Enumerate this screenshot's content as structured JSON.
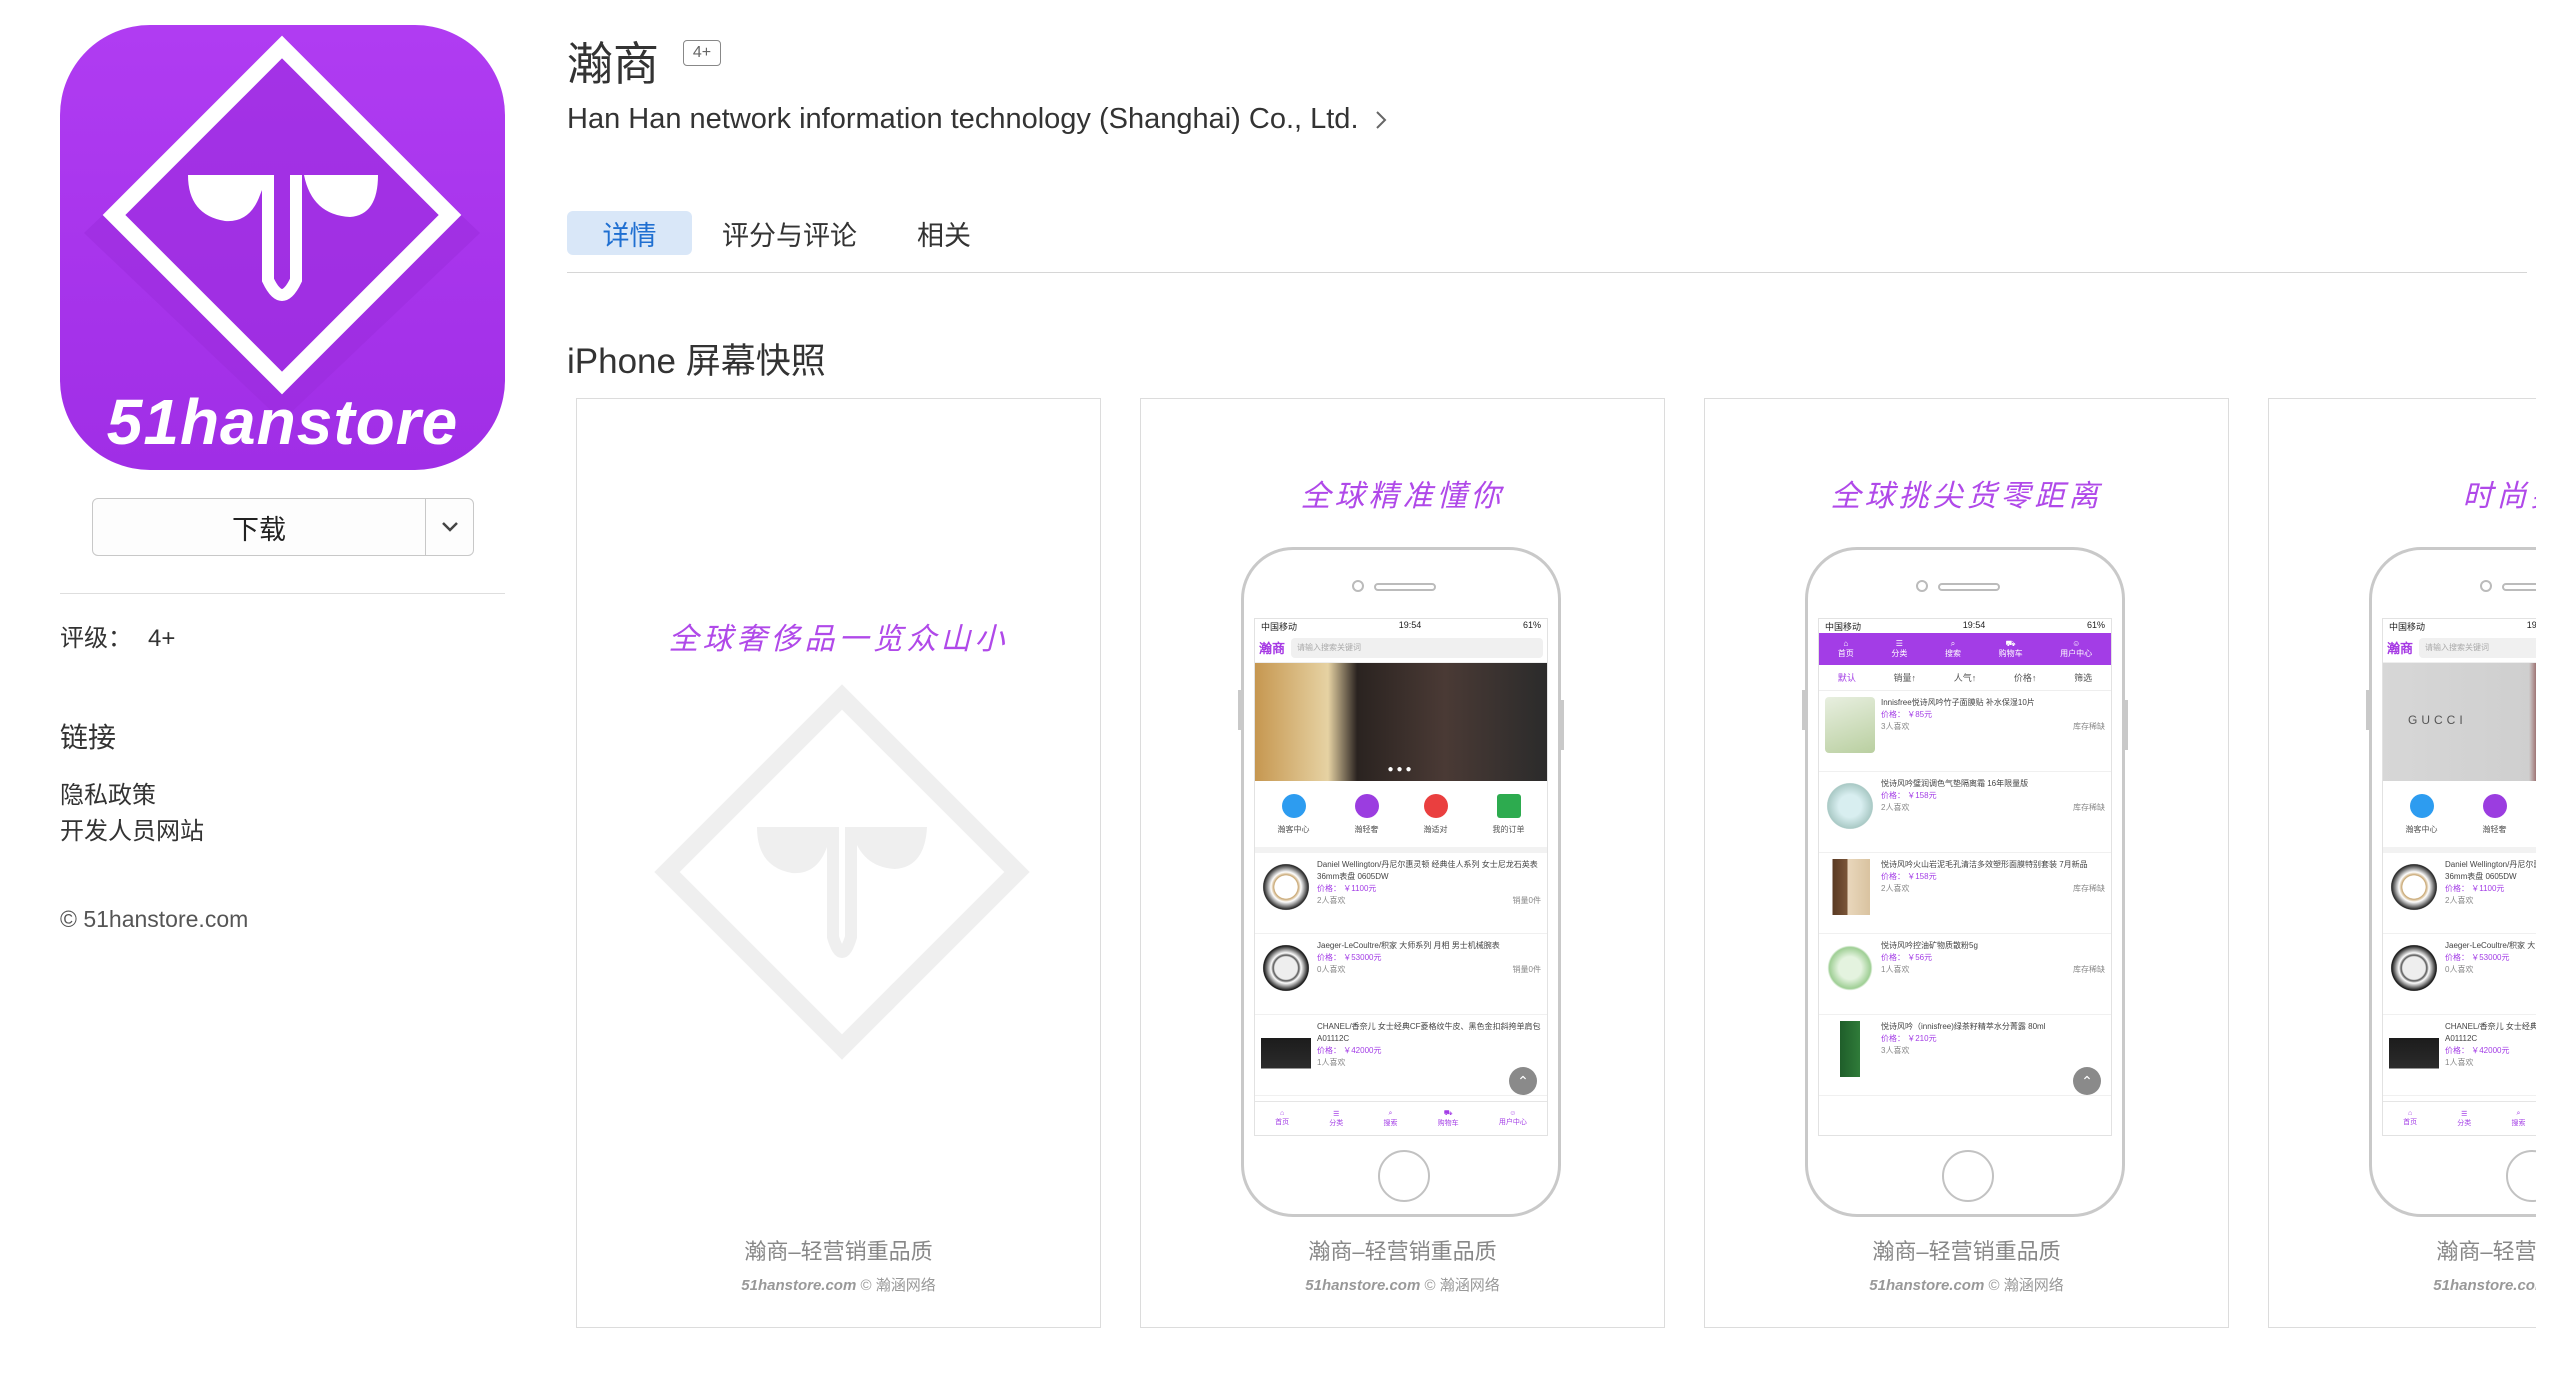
{
  "app": {
    "title": "瀚商",
    "age_badge": "4+",
    "developer": "Han Han network information technology (Shanghai) Co., Ltd.",
    "icon_wordmark": "51hanstore",
    "accent_color": "#a83aec"
  },
  "sidebar": {
    "download_label": "下载",
    "rating_label": "评级：",
    "rating_value": "4+",
    "links_heading": "链接",
    "links": [
      "隐私政策",
      "开发人员网站"
    ],
    "copyright": "© 51hanstore.com"
  },
  "tabs": [
    {
      "label": "详情",
      "active": true
    },
    {
      "label": "评分与评论",
      "active": false
    },
    {
      "label": "相关",
      "active": false
    }
  ],
  "screenshots_section": {
    "title": "iPhone 屏幕快照",
    "caption": "瀚商–轻营销重品质",
    "credit_site": "51hanstore.com",
    "credit_company": "© 瀚涵网络",
    "shots": [
      {
        "headline": "全球奢侈品一览众山小"
      },
      {
        "headline": "全球精准懂你"
      },
      {
        "headline": "全球挑尖货零距离"
      },
      {
        "headline": "时尚买手"
      }
    ]
  },
  "phone_ui": {
    "carrier": "中国移动",
    "time": "19:54",
    "battery": "61%",
    "logo": "瀚商",
    "search_placeholder": "请输入搜索关键词",
    "quicknav": [
      "瀚客中心",
      "瀚轻奢",
      "瀚适对",
      "我的订单"
    ],
    "tabbar": [
      "首页",
      "分类",
      "搜索",
      "购物车",
      "用户中心"
    ],
    "sort": [
      "默认",
      "销量↑",
      "人气↑",
      "价格↑",
      "筛选"
    ],
    "watches": [
      {
        "name": "Daniel Wellington/丹尼尔惠灵顿 经典佳人系列 女士尼龙石英表 36mm表盘 0605DW",
        "price": "价格： ￥1100元",
        "likes": "2人喜欢",
        "stock": "销量0件"
      },
      {
        "name": "Jaeger-LeCoultre/积家 大师系列 月相 男士机械腕表",
        "price": "价格： ￥53000元",
        "likes": "0人喜欢",
        "stock": "销量0件"
      },
      {
        "name": "CHANEL/香奈儿 女士经典CF菱格纹牛皮、黑色金扣斜挎单肩包 A01112C",
        "price": "价格： ￥42000元",
        "likes": "1人喜欢",
        "stock": ""
      }
    ],
    "cosmetics": [
      {
        "name": "Innisfree悦诗风吟竹子面膜贴 补水保湿10片",
        "price": "价格： ￥85元",
        "likes": "3人喜欢",
        "stock": "库存稀缺"
      },
      {
        "name": "悦诗风吟璧润调色气垫隔离霜 16年限量版",
        "price": "价格： ￥158元",
        "likes": "2人喜欢",
        "stock": "库存稀缺"
      },
      {
        "name": "悦诗风吟火山岩泥毛孔清洁多效塑形面膜特别套装 7月新品",
        "price": "价格： ￥158元",
        "likes": "2人喜欢",
        "stock": "库存稀缺"
      },
      {
        "name": "悦诗风吟控油矿物质散粉5g",
        "price": "价格： ￥56元",
        "likes": "1人喜欢",
        "stock": "库存稀缺"
      },
      {
        "name": "悦诗风吟（innisfree)绿茶籽精萃水分菁露 80ml",
        "price": "价格： ￥210元",
        "likes": "3人喜欢",
        "stock": ""
      }
    ]
  }
}
